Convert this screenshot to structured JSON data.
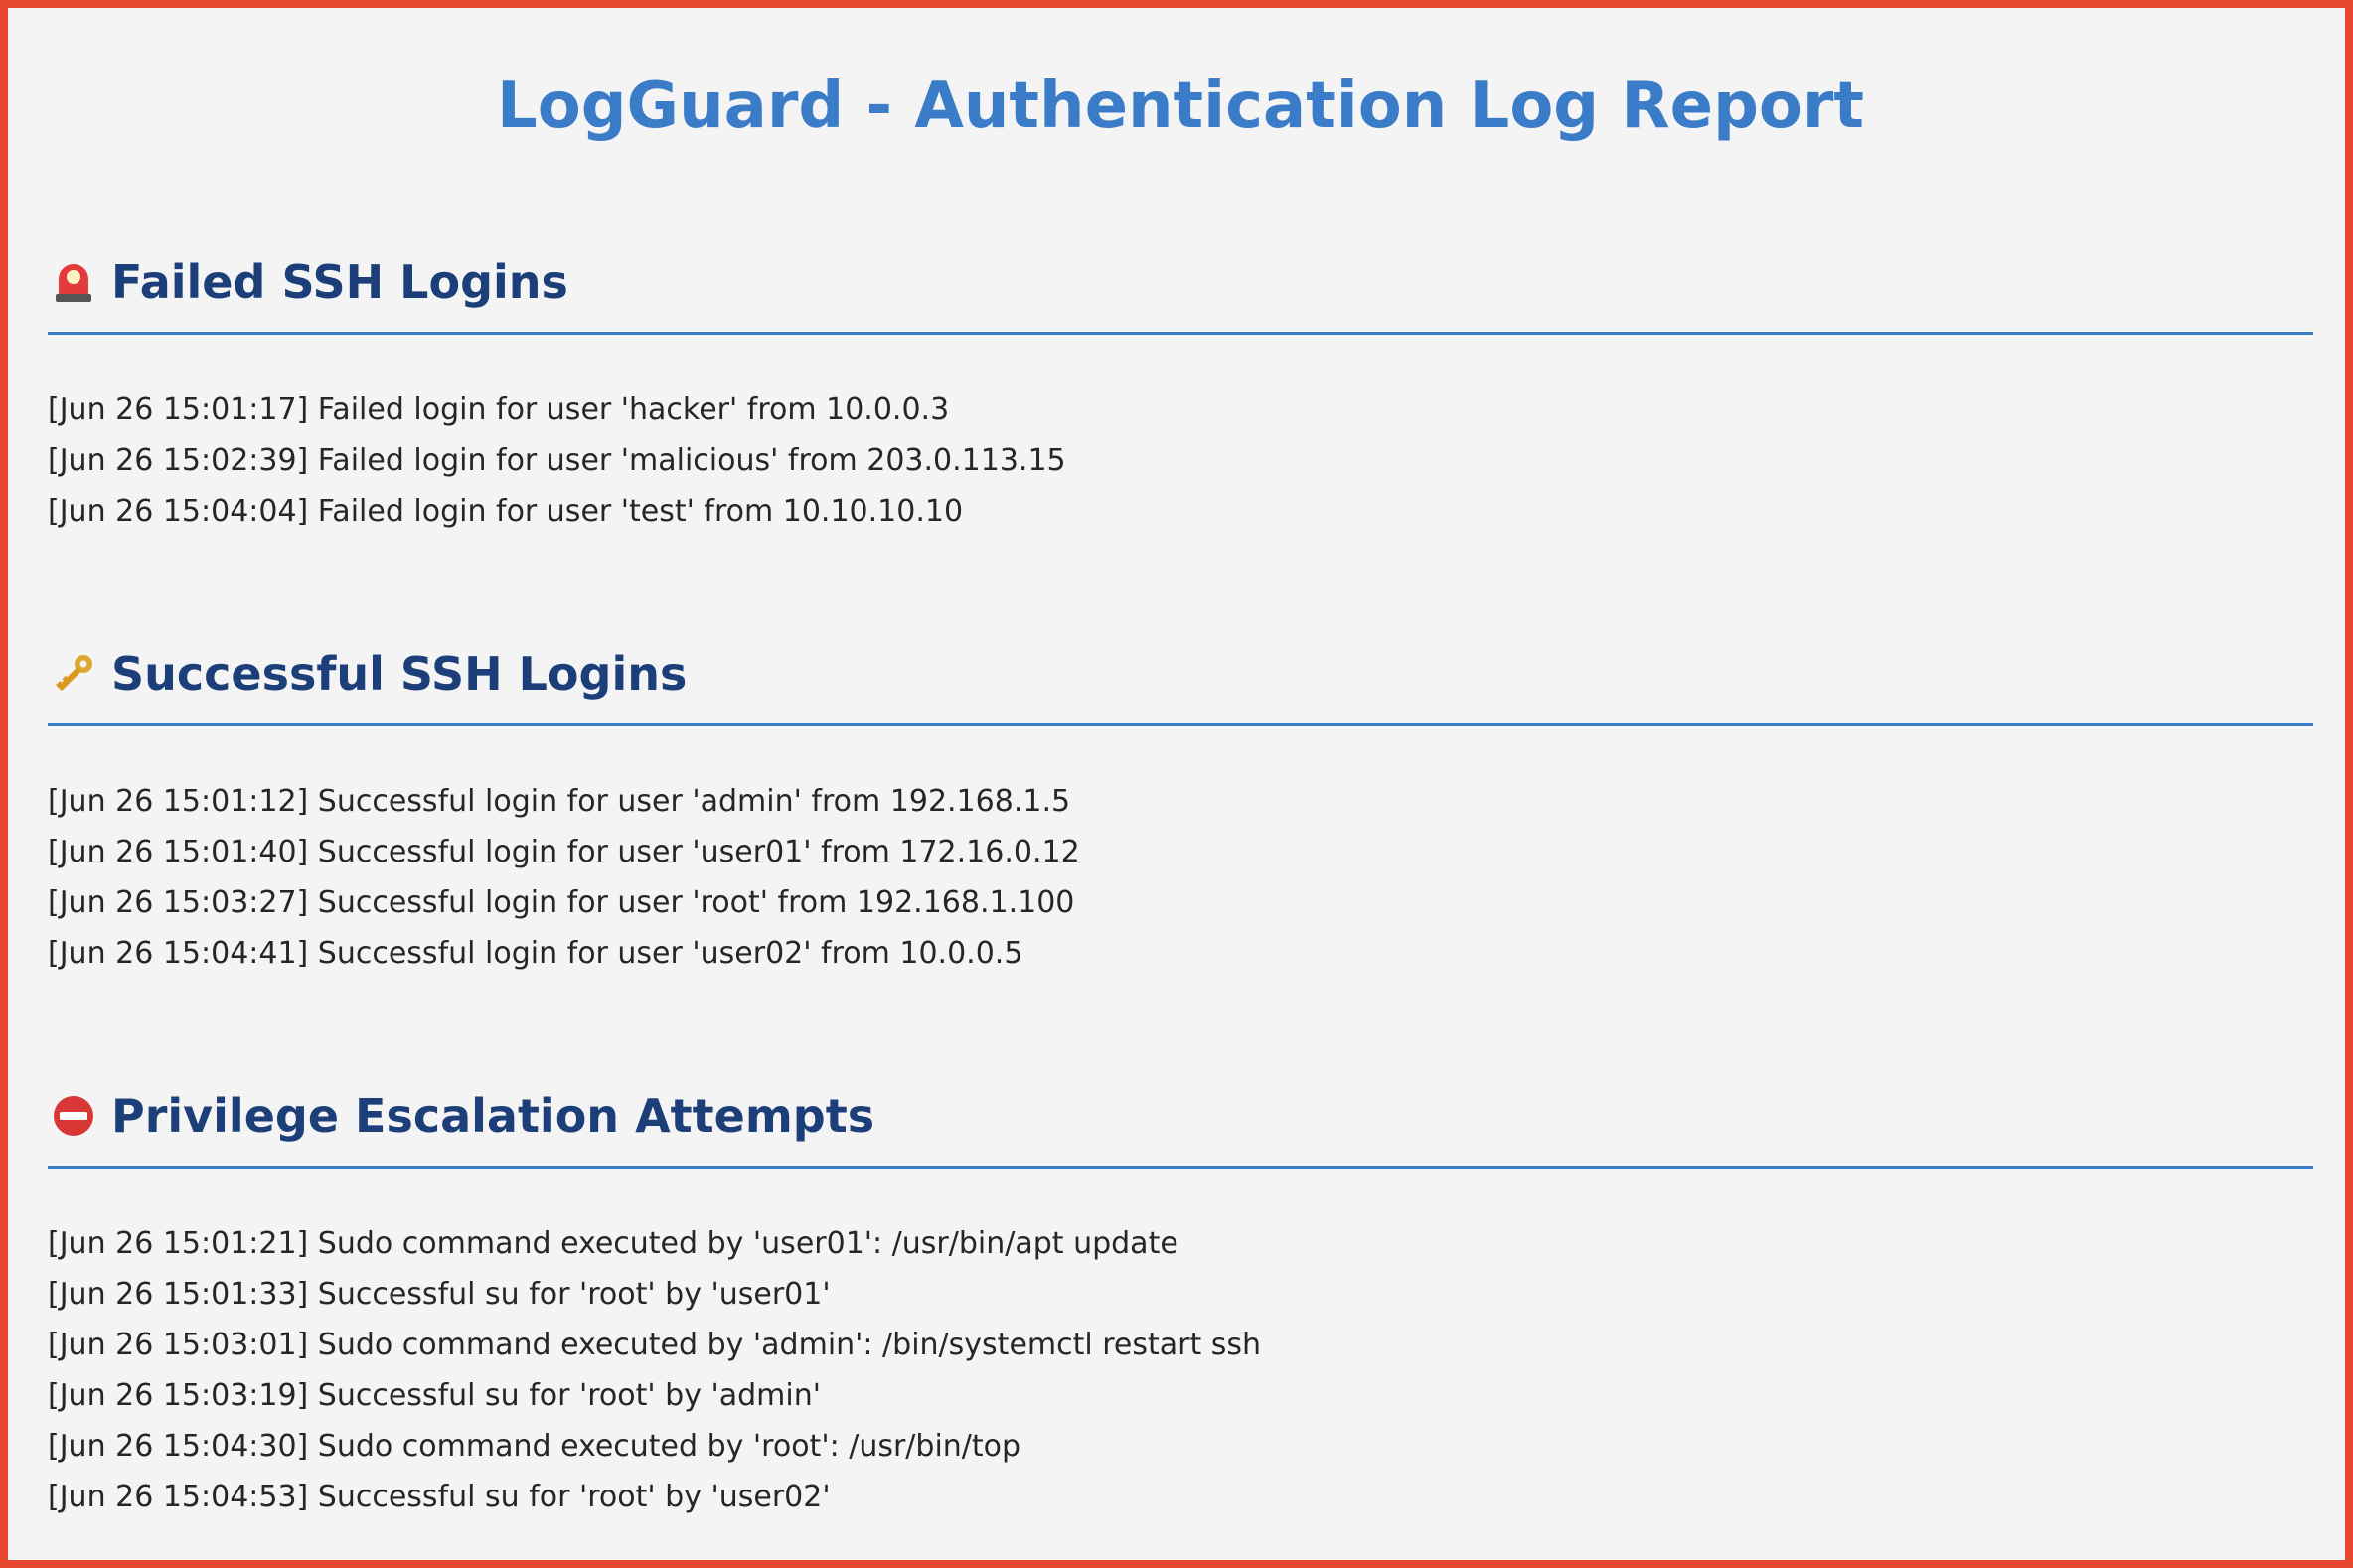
{
  "header": {
    "title": "LogGuard - Authentication Log Report"
  },
  "sections": [
    {
      "title": "Failed SSH Logins",
      "icon": "siren-icon",
      "entries": [
        "[Jun 26 15:01:17] Failed login for user 'hacker' from 10.0.0.3",
        "[Jun 26 15:02:39] Failed login for user 'malicious' from 203.0.113.15",
        "[Jun 26 15:04:04] Failed login for user 'test' from 10.10.10.10"
      ]
    },
    {
      "title": "Successful SSH Logins",
      "icon": "key-icon",
      "entries": [
        "[Jun 26 15:01:12] Successful login for user 'admin' from 192.168.1.5",
        "[Jun 26 15:01:40] Successful login for user 'user01' from 172.16.0.12",
        "[Jun 26 15:03:27] Successful login for user 'root' from 192.168.1.100",
        "[Jun 26 15:04:41] Successful login for user 'user02' from 10.0.0.5"
      ]
    },
    {
      "title": "Privilege Escalation Attempts",
      "icon": "no-entry-icon",
      "entries": [
        "[Jun 26 15:01:21] Sudo command executed by 'user01': /usr/bin/apt update",
        "[Jun 26 15:01:33] Successful su for 'root' by 'user01'",
        "[Jun 26 15:03:01] Sudo command executed by 'admin': /bin/systemctl restart ssh",
        "[Jun 26 15:03:19] Successful su for 'root' by 'admin'",
        "[Jun 26 15:04:30] Sudo command executed by 'root': /usr/bin/top",
        "[Jun 26 15:04:53] Successful su for 'root' by 'user02'"
      ]
    }
  ],
  "colors": {
    "border": "#e8472f",
    "background": "#f4f4f4",
    "title": "#3a7cc8",
    "section_title": "#1c3f7a",
    "rule": "#3a7cc8",
    "text": "#262626"
  }
}
